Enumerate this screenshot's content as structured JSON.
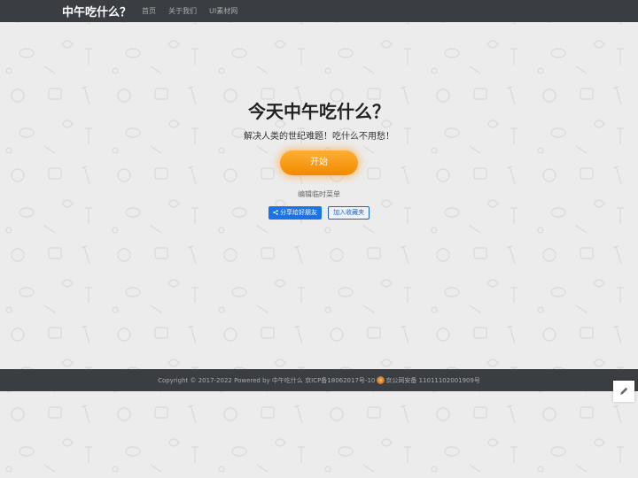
{
  "navbar": {
    "brand": "中午吃什么？",
    "links": [
      "首页",
      "关于我们",
      "UI素材网"
    ]
  },
  "hero": {
    "title": "今天中午吃什么？",
    "subtitle": "解决人类的世纪难题！吃什么不用愁！",
    "start_label": "开始",
    "edit_menu_label": "编辑临时菜单",
    "share_label": "分享给好朋友",
    "favorite_label": "加入收藏夹"
  },
  "footer": {
    "copyright": "Copyright © 2017-2022 Powered by 中午吃什么 京ICP备18062017号-10",
    "police_record": "京公网安备 11011102001909号"
  },
  "colors": {
    "navbar_bg": "#3a3d42",
    "start_button": "#f8a01c",
    "share_button": "#1a73e8"
  },
  "icons": {
    "share": "share-icon",
    "police": "police-badge-icon",
    "edit": "pencil-icon"
  }
}
